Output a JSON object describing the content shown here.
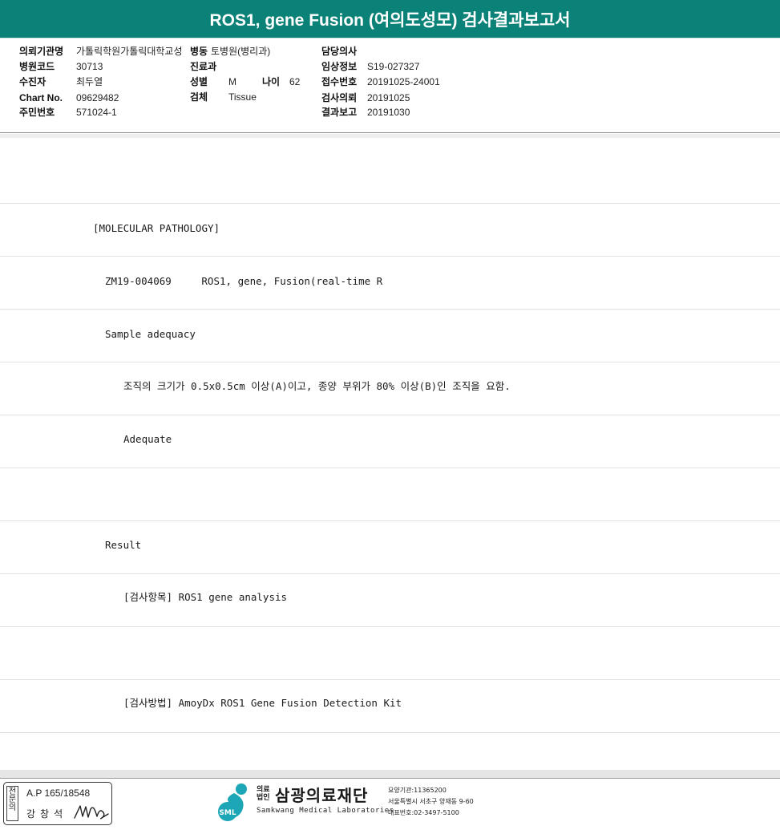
{
  "report_title": "ROS1, gene Fusion (여의도성모) 검사결과보고서",
  "header": {
    "institution": {
      "label": "의뢰기관명",
      "value": "가톨릭학원가톨릭대학교성"
    },
    "ward": {
      "label": "병동",
      "value": "토병원(병리과)"
    },
    "doctor": {
      "label": "담당의사",
      "value": ""
    },
    "hospital_code": {
      "label": "병원코드",
      "value": "30713"
    },
    "department": {
      "label": "진료과",
      "value": ""
    },
    "clinical_info": {
      "label": "임상정보",
      "value": "S19-027327"
    },
    "patient": {
      "label": "수진자",
      "value": "최두열"
    },
    "sex": {
      "label": "성별",
      "value": "M"
    },
    "age": {
      "label": "나이",
      "value": "62"
    },
    "receipt_no": {
      "label": "접수번호",
      "value": "20191025-24001"
    },
    "chart_no": {
      "label": "Chart No.",
      "value": "09629482"
    },
    "specimen": {
      "label": "검체",
      "value": "Tissue"
    },
    "test_request": {
      "label": "검사의뢰",
      "value": "20191025"
    },
    "resident_no": {
      "label": "주민번호",
      "value": "571024-1"
    },
    "result_report": {
      "label": "결과보고",
      "value": "20191030"
    }
  },
  "rows": [
    "",
    "[MOLECULAR PATHOLOGY]",
    "ZM19-004069     ROS1, gene, Fusion(real-time R",
    "Sample adequacy",
    "조직의 크기가 0.5x0.5cm 이상(A)이고, 종양 부위가 80% 이상(B)인 조직을 요함.",
    "Adequate",
    "",
    "Result",
    "[검사항목] ROS1 gene analysis",
    "",
    "[검사방법] AmoyDx ROS1 Gene Fusion Detection Kit",
    ""
  ],
  "footer": {
    "stamp_vertical": "전문의",
    "stamp_license": "A.P 165/18548",
    "stamp_name": "강창석",
    "logo_prefix_1": "의료",
    "logo_prefix_2": "법인",
    "logo_name": "삼광의료재단",
    "logo_english": "Samkwang Medical Laboratories",
    "logo_badge": "SML",
    "care_institution": "요양기관:11365200",
    "address": "서울특별시 서초구 양재동 9-60",
    "phone": "대표번호:02-3497-5100"
  },
  "colors": {
    "title_bar": "#0b8277",
    "logo_accent": "#1da6b5"
  }
}
